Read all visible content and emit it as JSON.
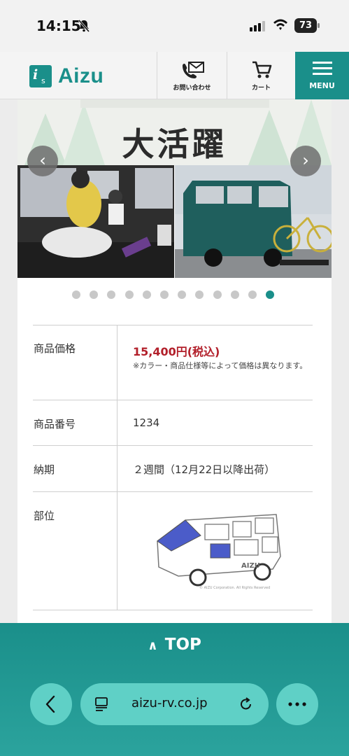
{
  "status_bar": {
    "time": "14:15",
    "battery": "73"
  },
  "header": {
    "logo_text": "Aizu",
    "logo_mark": "i",
    "logo_mark_sub": "s",
    "contact_label": "お問い合わせ",
    "cart_label": "カート",
    "menu_label": "MENU"
  },
  "slider": {
    "banner_title": "大活躍",
    "dot_count": 12,
    "active_index": 11
  },
  "spec": {
    "price_label": "商品価格",
    "price_value": "15,400円(税込)",
    "price_note": "※カラー・商品仕様等によって価格は異なります。",
    "number_label": "商品番号",
    "number_value": "1234",
    "delivery_label": "納期",
    "delivery_value": "２週間（12月22日以降出荷）",
    "part_label": "部位",
    "van_brand": "AIZU",
    "van_copyright": "© AIZU Corporation. All Rights Reserved"
  },
  "footer": {
    "top_label": "TOP"
  },
  "browser": {
    "url": "aizu-rv.co.jp"
  },
  "colors": {
    "brand": "#1a8f8a",
    "price": "#b21f2a",
    "browser_pill": "#5fd0c6"
  }
}
